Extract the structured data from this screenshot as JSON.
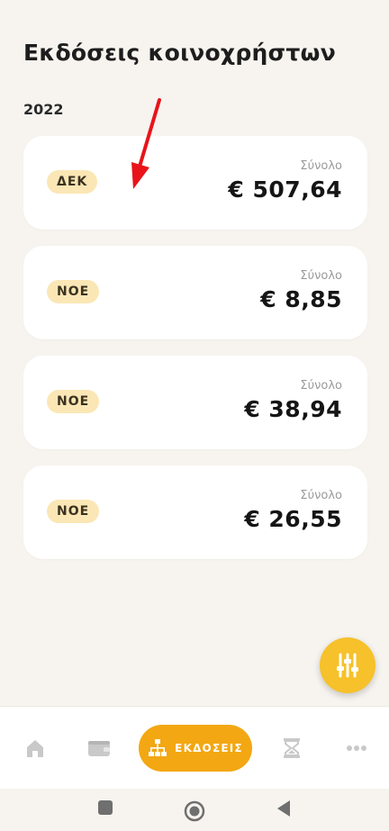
{
  "header": {
    "title": "Εκδόσεις κοινοχρήστων"
  },
  "year": "2022",
  "issues": [
    {
      "month": "ΔΕΚ",
      "total_label": "Σύνολο",
      "amount": "€ 507,64"
    },
    {
      "month": "ΝΟΕ",
      "total_label": "Σύνολο",
      "amount": "€ 8,85"
    },
    {
      "month": "ΝΟΕ",
      "total_label": "Σύνολο",
      "amount": "€ 38,94"
    },
    {
      "month": "ΝΟΕ",
      "total_label": "Σύνολο",
      "amount": "€ 26,55"
    }
  ],
  "fab": {
    "icon": "sliders-icon"
  },
  "bottom_nav": {
    "items": [
      {
        "icon": "home-icon"
      },
      {
        "icon": "wallet-icon"
      },
      {
        "icon": "hierarchy-icon",
        "label": "ΕΚΔΟΣΕΙΣ",
        "active": true
      },
      {
        "icon": "hourglass-icon"
      },
      {
        "icon": "more-icon"
      }
    ]
  },
  "system_nav": {
    "buttons": [
      "square-icon",
      "circle-icon",
      "back-triangle-icon"
    ]
  },
  "colors": {
    "background": "#f7f4ef",
    "card": "#ffffff",
    "badge": "#fbe7b5",
    "accent": "#f3a712",
    "fab": "#f6c12a",
    "annotation": "#e8141a"
  }
}
